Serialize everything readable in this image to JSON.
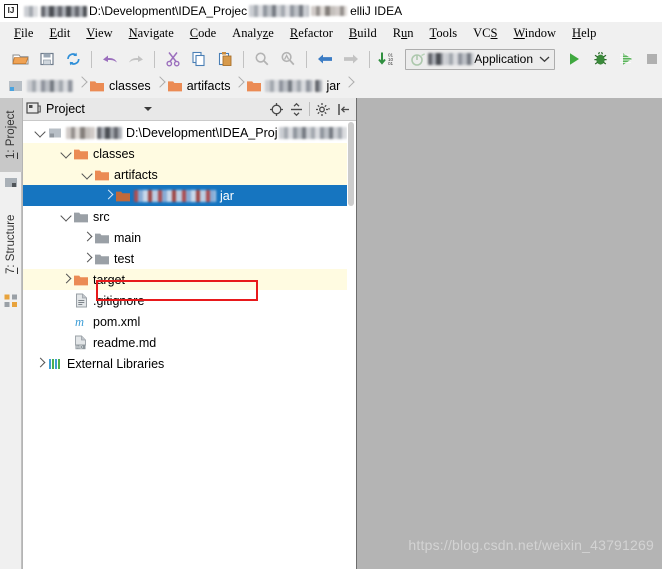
{
  "titlebar": {
    "app_icon": "intellij-logo-icon",
    "logo_text": "IJ",
    "path_visible": "D:\\Development\\IDEA_Projec",
    "suffix": "elliJ IDEA"
  },
  "menubar": {
    "items": [
      {
        "mnemonic": "F",
        "rest": "ile"
      },
      {
        "mnemonic": "E",
        "rest": "dit"
      },
      {
        "mnemonic": "V",
        "rest": "iew"
      },
      {
        "mnemonic": "N",
        "rest": "avigate"
      },
      {
        "mnemonic": "C",
        "rest": "ode"
      },
      {
        "pre": "Analy",
        "mnemonic": "z",
        "rest": "e"
      },
      {
        "mnemonic": "R",
        "rest": "efactor"
      },
      {
        "mnemonic": "B",
        "rest": "uild"
      },
      {
        "pre": "R",
        "mnemonic": "u",
        "rest": "n"
      },
      {
        "mnemonic": "T",
        "rest": "ools"
      },
      {
        "pre": "VC",
        "mnemonic": "S",
        "rest": ""
      },
      {
        "mnemonic": "W",
        "rest": "indow"
      },
      {
        "mnemonic": "H",
        "rest": "elp"
      }
    ]
  },
  "toolbar": {
    "buttons": [
      {
        "name": "open-folder-icon",
        "title": "Open"
      },
      {
        "name": "save-all-icon",
        "title": "Save All"
      },
      {
        "name": "sync-refresh-icon",
        "title": "Synchronize"
      },
      {
        "name": "undo-icon",
        "title": "Undo"
      },
      {
        "name": "redo-icon",
        "title": "Redo"
      },
      {
        "name": "cut-icon",
        "title": "Cut"
      },
      {
        "name": "copy-icon",
        "title": "Copy"
      },
      {
        "name": "paste-icon",
        "title": "Paste"
      },
      {
        "name": "find-icon",
        "title": "Find"
      },
      {
        "name": "replace-icon",
        "title": "Replace"
      },
      {
        "name": "back-arrow-icon",
        "title": "Back"
      },
      {
        "name": "forward-arrow-icon",
        "title": "Forward"
      },
      {
        "name": "compile-icon",
        "title": "Compile"
      }
    ],
    "run_config": {
      "label": "Application",
      "icon": "run-config-icon",
      "dropdown": "chevron-down-icon"
    },
    "run_label": "Run",
    "debug_label": "Debug",
    "coverage_label": "Run with Coverage",
    "stop_label": "Stop"
  },
  "breadcrumb": {
    "items": [
      {
        "label": "",
        "icon": "module-icon",
        "blurred": true
      },
      {
        "label": "classes",
        "icon": "folder-orange-icon",
        "blurred": false
      },
      {
        "label": "artifacts",
        "icon": "folder-orange-icon",
        "blurred": false
      },
      {
        "label": "jar",
        "icon": "folder-orange-icon",
        "blurred": true
      }
    ]
  },
  "sidestrip": {
    "tabs": [
      {
        "label": "1: Project",
        "mnemonic": "1",
        "rest": ": Project",
        "selected": true,
        "icon": "project-tool-icon"
      },
      {
        "label": "7: Structure",
        "mnemonic": "7",
        "rest": ": Structure",
        "selected": false,
        "icon": "structure-tool-icon"
      }
    ]
  },
  "project_panel": {
    "title": "Project",
    "dropdown_icon": "chevron-down-icon",
    "actions": [
      {
        "name": "locate-target-icon",
        "title": "Select Opened File"
      },
      {
        "name": "collapse-all-icon",
        "title": "Collapse All"
      },
      {
        "name": "settings-gear-icon",
        "title": "Settings"
      },
      {
        "name": "hide-panel-icon",
        "title": "Hide"
      }
    ],
    "tree": [
      {
        "id": "root",
        "label": "D:\\Development\\IDEA_Proj",
        "indent": 0,
        "arrow": "down",
        "icon": "module-icon",
        "state": "normal",
        "blur_before": true,
        "blur_after": true,
        "truncated": true
      },
      {
        "id": "classes",
        "label": "classes",
        "indent": 1,
        "arrow": "down",
        "icon": "folder-orange-icon",
        "state": "highlight"
      },
      {
        "id": "artifacts",
        "label": "artifacts",
        "indent": 2,
        "arrow": "down",
        "icon": "folder-orange-icon",
        "state": "highlight"
      },
      {
        "id": "jar",
        "label": "jar",
        "indent": 3,
        "arrow": "right",
        "icon": "folder-orange-icon",
        "state": "selected",
        "blur_before": true,
        "annotated": true
      },
      {
        "id": "src",
        "label": "src",
        "indent": 1,
        "arrow": "down",
        "icon": "folder-gray-icon",
        "state": "normal"
      },
      {
        "id": "main",
        "label": "main",
        "indent": 2,
        "arrow": "right",
        "icon": "folder-gray-icon",
        "state": "normal"
      },
      {
        "id": "test",
        "label": "test",
        "indent": 2,
        "arrow": "right",
        "icon": "folder-gray-icon",
        "state": "normal"
      },
      {
        "id": "target",
        "label": "target",
        "indent": 1,
        "arrow": "right",
        "icon": "folder-orange-icon",
        "state": "highlight"
      },
      {
        "id": "gitignore",
        "label": ".gitignore",
        "indent": 1,
        "arrow": "none",
        "icon": "file-text-icon",
        "state": "normal"
      },
      {
        "id": "pom",
        "label": "pom.xml",
        "indent": 1,
        "arrow": "none",
        "icon": "maven-m-icon",
        "state": "normal"
      },
      {
        "id": "readme",
        "label": "readme.md",
        "indent": 1,
        "arrow": "none",
        "icon": "markdown-file-icon",
        "state": "normal"
      },
      {
        "id": "extlibs",
        "label": "External Libraries",
        "indent": 0,
        "arrow": "right",
        "icon": "libraries-icon",
        "state": "normal"
      }
    ]
  },
  "editor": {
    "watermark": "https://blog.csdn.net/weixin_43791269"
  },
  "colors": {
    "selection_blue": "#1675c0",
    "annotation_red": "#e8191b",
    "highlight_yellow": "#fffbe1",
    "folder_orange": "#eb8b54",
    "folder_gray": "#9aa0a6",
    "editor_gray": "#b4b4b4",
    "run_green": "#3fa83f"
  }
}
